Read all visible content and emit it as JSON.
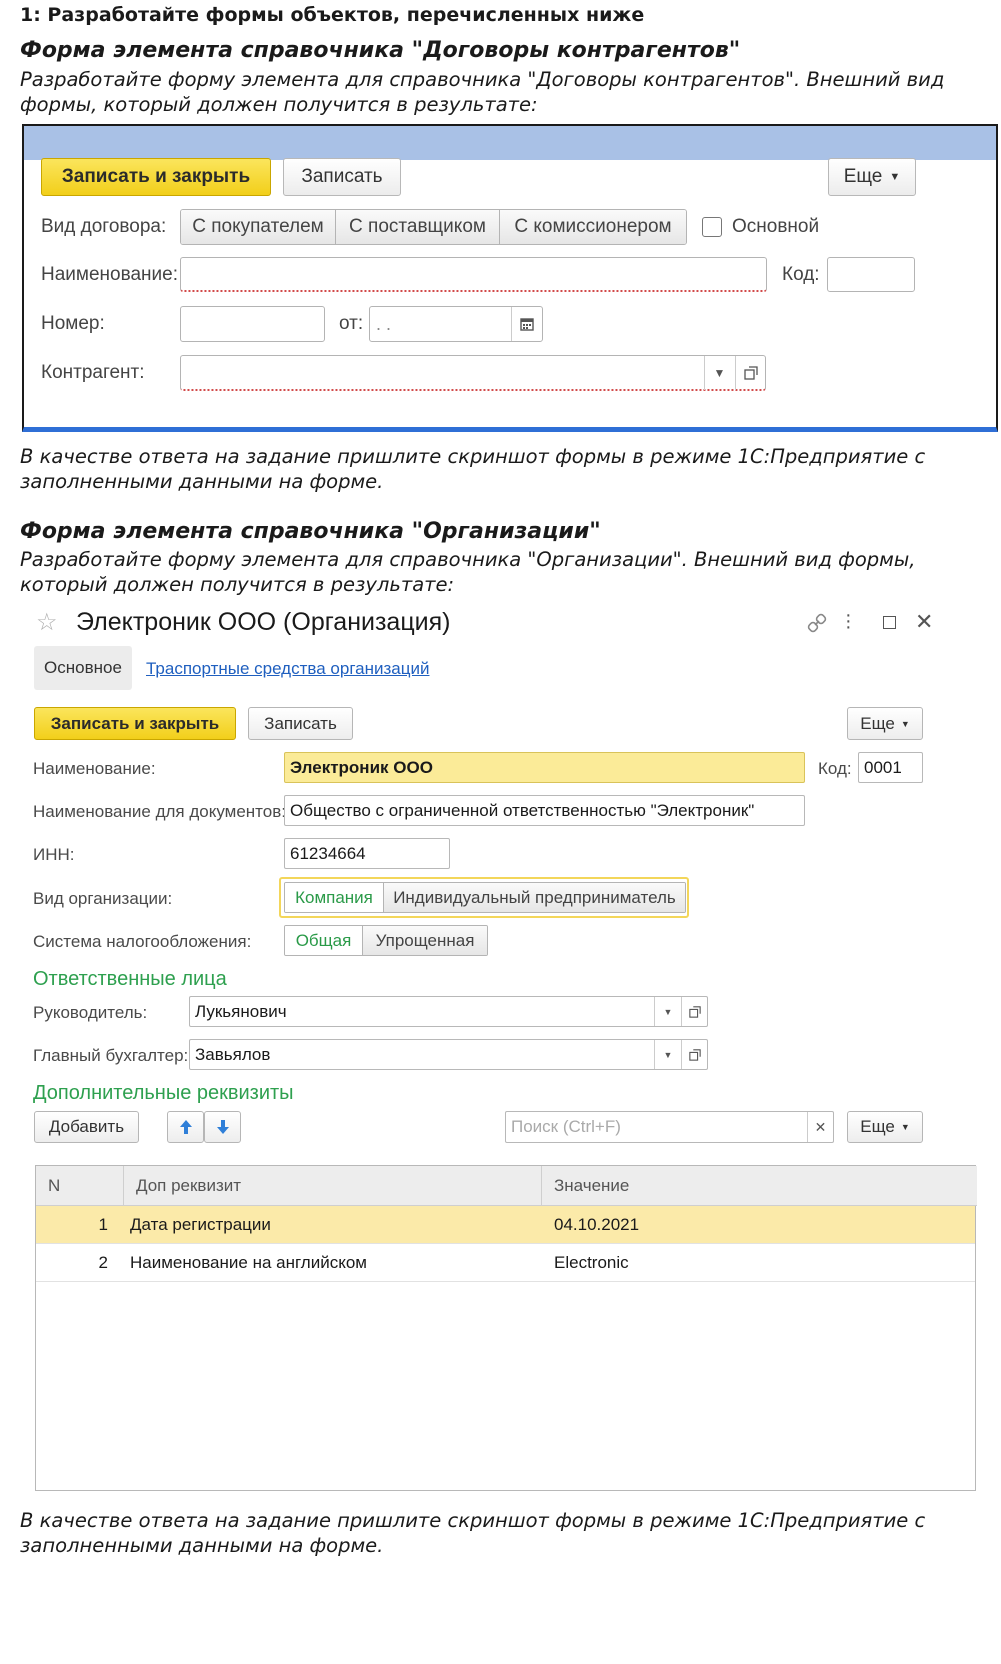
{
  "task": {
    "title": "1: Разработайте формы объектов, перечисленных ниже"
  },
  "section1": {
    "heading": "Форма элемента справочника \"Договоры контрагентов\"",
    "intro_line1": "Разработайте форму элемента для справочника \"Договоры контрагентов\". Внешний вид",
    "intro_line2": "формы, который должен получится в результате:",
    "answer_line1": "В качестве ответа на задание пришлите скриншот формы в режиме 1С:Предприятие с",
    "answer_line2": "заполненными данными на форме."
  },
  "form1": {
    "save_close": "Записать и закрыть",
    "save": "Записать",
    "more": "Еще",
    "contract_type_label": "Вид договора:",
    "contract_types": [
      "С покупателем",
      "С поставщиком",
      "С комиссионером"
    ],
    "main_checkbox_label": "Основной",
    "name_label": "Наименование:",
    "code_label": "Код:",
    "number_label": "Номер:",
    "date_label": "от:",
    "date_placeholder": " .  .",
    "counterparty_label": "Контрагент:"
  },
  "section2": {
    "heading": "Форма элемента справочника \"Организации\"",
    "intro_line1": "Разработайте форму элемента для справочника \"Организации\". Внешний вид формы,",
    "intro_line2": "который должен получится в результате:",
    "answer_line1": "В качестве ответа на задание пришлите скриншот формы в режиме 1С:Предприятие с",
    "answer_line2": "заполненными данными на форме."
  },
  "form2": {
    "window_title": "Электроник ООО (Организация)",
    "tab_main": "Основное",
    "tab_vehicles": "Траспортные средства организаций",
    "save_close": "Записать и закрыть",
    "save": "Записать",
    "more": "Еще",
    "name_label": "Наименование:",
    "name_value": "Электроник ООО",
    "code_label": "Код:",
    "code_value": "0001",
    "docname_label": "Наименование для документов:",
    "docname_value": "Общество с ограниченной ответственностью \"Электроник\"",
    "inn_label": "ИНН:",
    "inn_value": "61234664",
    "org_type_label": "Вид организации:",
    "org_types": [
      "Компания",
      "Индивидуальный предприниматель"
    ],
    "tax_label": "Система налогообложения:",
    "tax_types": [
      "Общая",
      "Упрощенная"
    ],
    "responsible_header": "Ответственные лица",
    "head_label": "Руководитель:",
    "head_value": "Лукьянович",
    "accountant_label": "Главный бухгалтер:",
    "accountant_value": "Завьялов",
    "extra_header": "Дополнительные реквизиты",
    "add_button": "Добавить",
    "search_placeholder": "Поиск (Ctrl+F)",
    "table_columns": [
      "N",
      "Доп реквизит",
      "Значение"
    ],
    "table_rows": [
      {
        "n": "1",
        "attr": "Дата регистрации",
        "value": "04.10.2021"
      },
      {
        "n": "2",
        "attr": "Наименование на английском",
        "value": "Electronic"
      }
    ]
  },
  "colors": {
    "accent_yellow": "#f2cf1a",
    "group_green": "#2ea04f",
    "link_blue": "#1f5fbf",
    "form_bar": "#a9c1e6"
  }
}
